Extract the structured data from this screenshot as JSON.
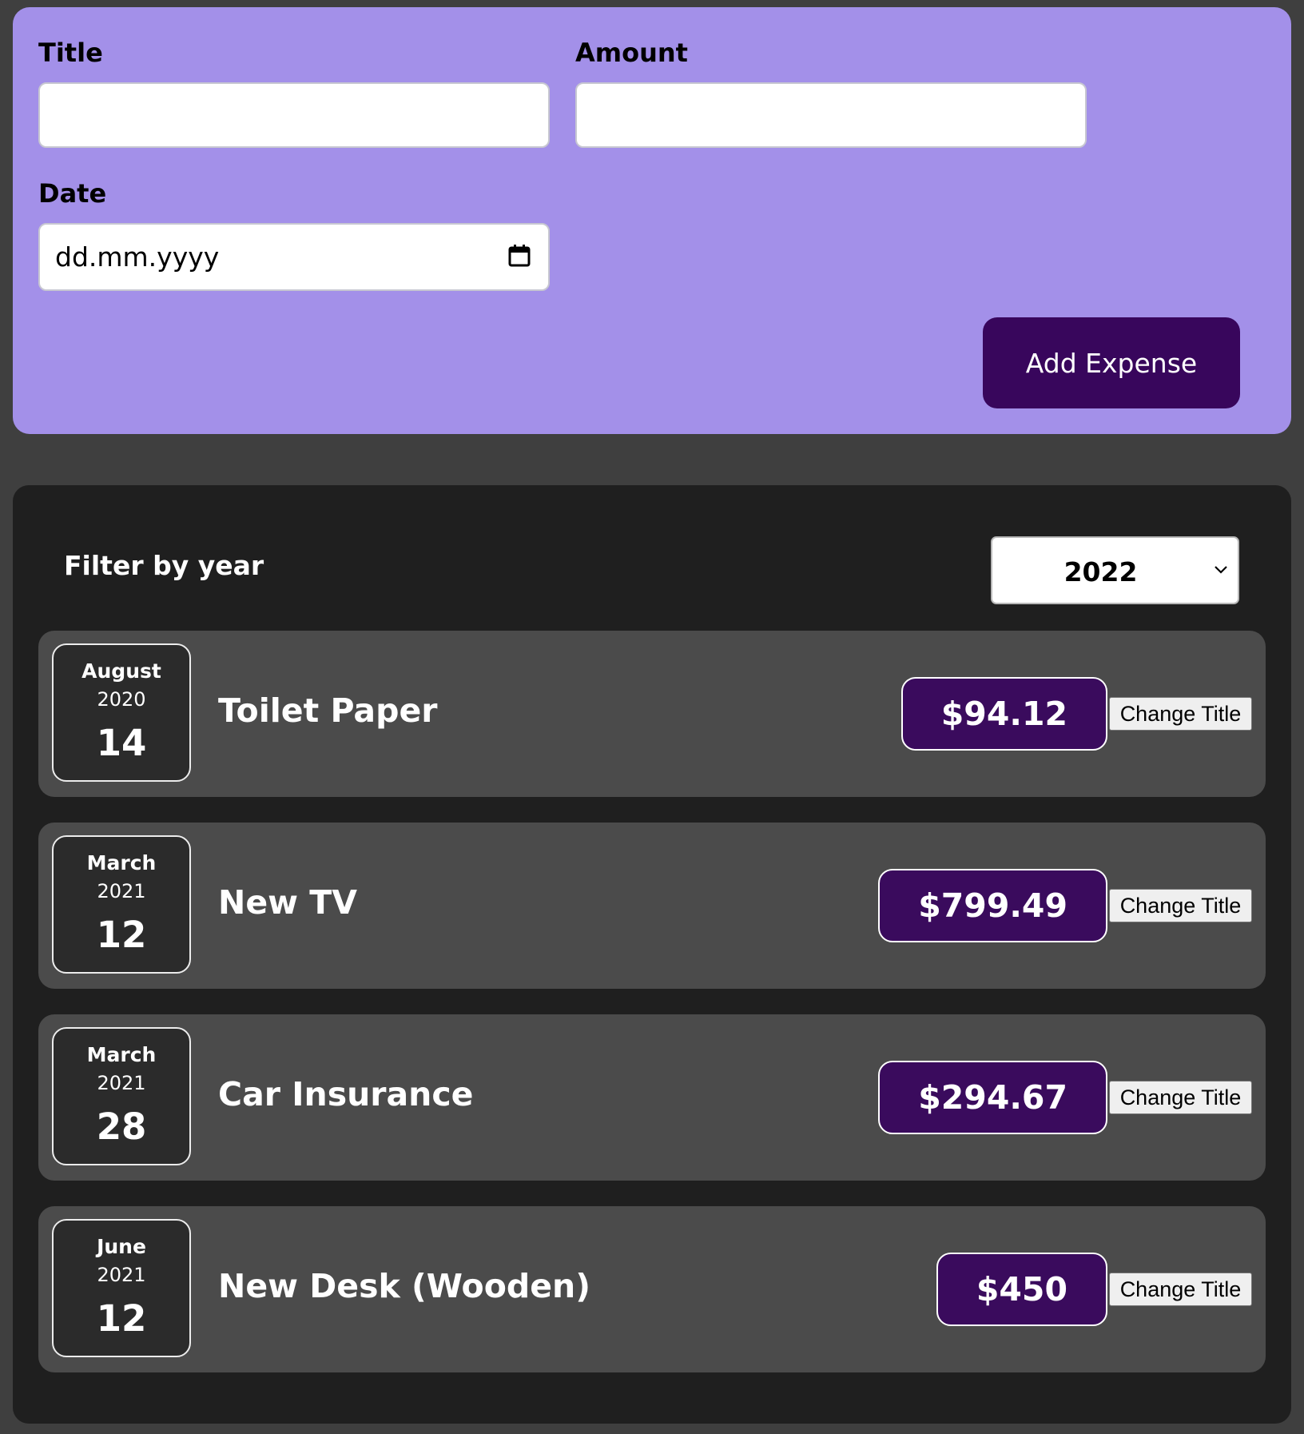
{
  "new_expense_form": {
    "title_label": "Title",
    "title_value": "",
    "amount_label": "Amount",
    "amount_value": "",
    "date_label": "Date",
    "date_placeholder": "dd.mm.yyyy",
    "calendar_icon": "calendar-icon",
    "submit_label": "Add Expense",
    "accent_color": "#a390e9",
    "button_color": "#38065c"
  },
  "expenses": {
    "filter_label": "Filter by year",
    "selected_year": "2022",
    "items": [
      {
        "month": "August",
        "year": "2020",
        "day": "14",
        "title": "Toilet Paper",
        "amount": "$94.12",
        "action_label": "Change Title"
      },
      {
        "month": "March",
        "year": "2021",
        "day": "12",
        "title": "New TV",
        "amount": "$799.49",
        "action_label": "Change Title"
      },
      {
        "month": "March",
        "year": "2021",
        "day": "28",
        "title": "Car Insurance",
        "amount": "$294.67",
        "action_label": "Change Title"
      },
      {
        "month": "June",
        "year": "2021",
        "day": "12",
        "title": "New Desk (Wooden)",
        "amount": "$450",
        "action_label": "Change Title"
      }
    ],
    "amount_color": "#3a0b5d"
  }
}
